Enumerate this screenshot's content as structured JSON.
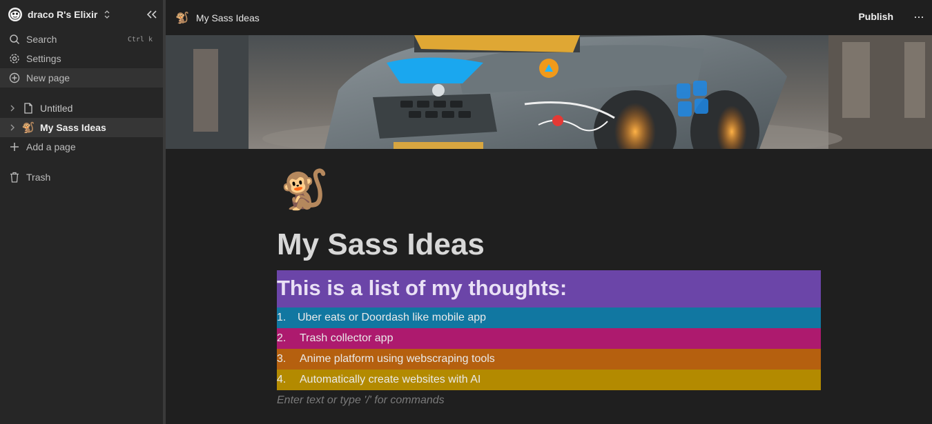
{
  "workspace": {
    "name": "draco R's Elixir"
  },
  "sidebar": {
    "menu": [
      {
        "label": "Search",
        "shortcut": "Ctrl k"
      },
      {
        "label": "Settings"
      },
      {
        "label": "New page"
      }
    ],
    "pages": [
      {
        "label": "Untitled"
      },
      {
        "label": "My Sass Ideas",
        "emoji": "🐒"
      }
    ],
    "add_page": "Add a page",
    "trash": "Trash"
  },
  "topbar": {
    "breadcrumb_emoji": "🐒",
    "breadcrumb": "My Sass Ideas",
    "publish": "Publish",
    "more": "···"
  },
  "page": {
    "emoji": "🐒",
    "title": "My Sass Ideas",
    "heading": "This is a list of my thoughts:",
    "list": [
      {
        "num": "1.",
        "text": "Uber eats or Doordash like mobile app",
        "color": "#1177a1"
      },
      {
        "num": "2.",
        "text": "Trash collector app",
        "color": "#ad1a6e"
      },
      {
        "num": "3.",
        "text": "Anime platform using webscraping tools",
        "color": "#b5600f"
      },
      {
        "num": "4.",
        "text": "Automatically create websites with AI",
        "color": "#b38a00"
      }
    ],
    "placeholder": "Enter text or type '/' for commands",
    "heading_color": "#6b45a8"
  }
}
